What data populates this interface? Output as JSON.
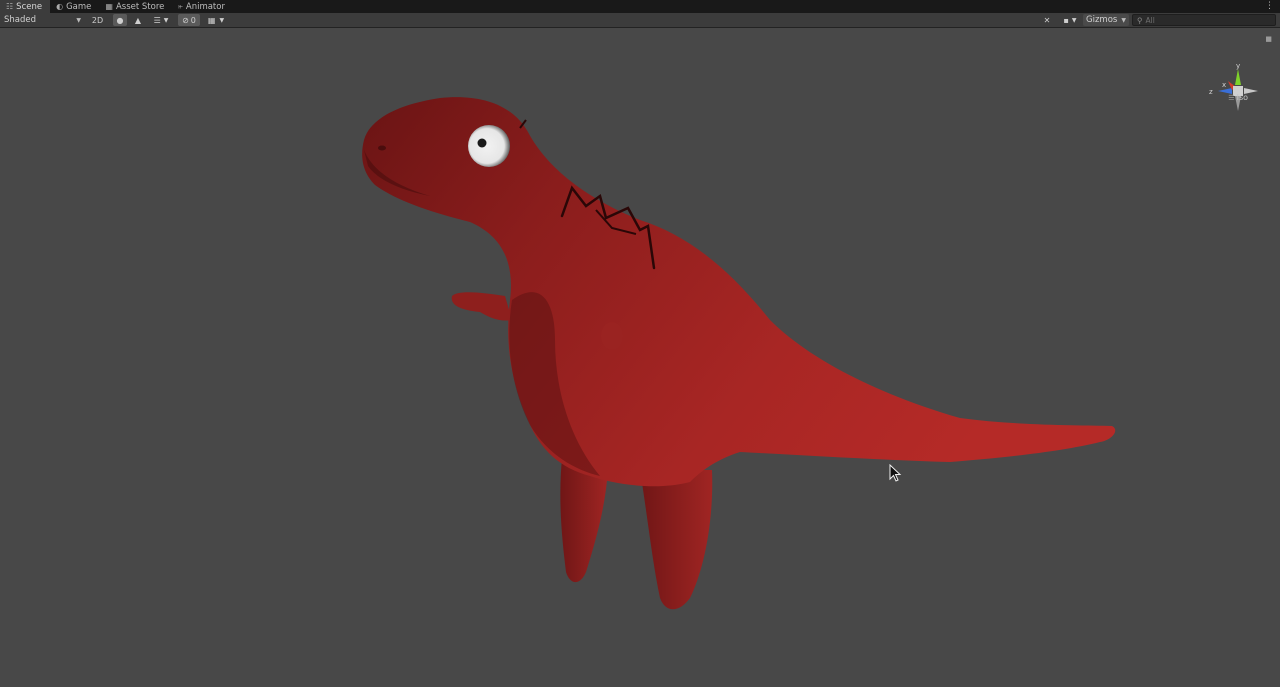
{
  "tabs": [
    {
      "label": "Scene",
      "icon": "scene-icon",
      "active": true
    },
    {
      "label": "Game",
      "icon": "gamepad-icon",
      "active": false
    },
    {
      "label": "Asset Store",
      "icon": "store-bag-icon",
      "active": false
    },
    {
      "label": "Animator",
      "icon": "animator-icon",
      "active": false
    }
  ],
  "toolbar": {
    "shading_mode": "Shaded",
    "mode_2d": "2D",
    "hidden_count": "0",
    "gizmos_label": "Gizmos",
    "search_placeholder": "All"
  },
  "gizmo": {
    "axis_y": "y",
    "axis_x": "x",
    "axis_z": "z",
    "projection": "Iso"
  },
  "colors": {
    "viewport_bg": "#484848",
    "toolbar_bg": "#3c3c3c",
    "tabbar_bg": "#191919",
    "dino_body": "#9b2220",
    "gizmo_x": "#d33a2c",
    "gizmo_y": "#7fd22a",
    "gizmo_z": "#3a6fd8"
  }
}
